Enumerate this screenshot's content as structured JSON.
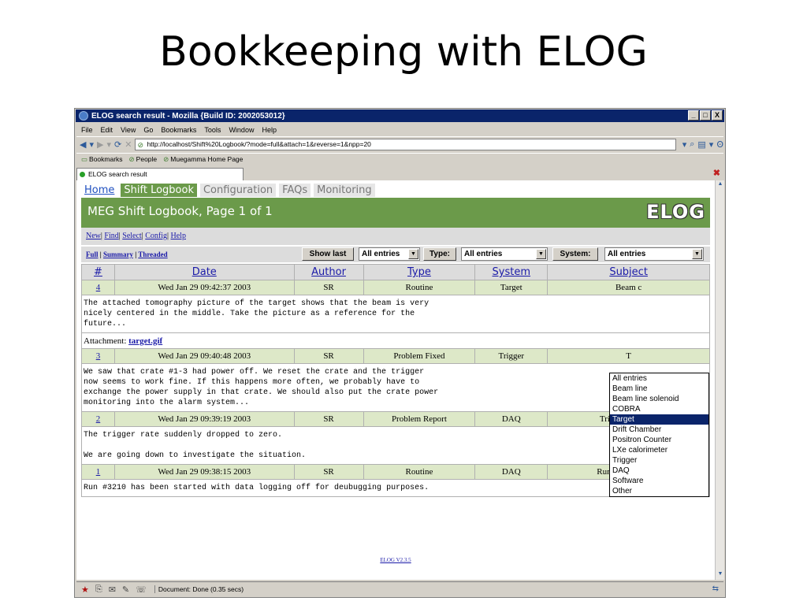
{
  "slide": {
    "title": "Bookkeeping with ELOG"
  },
  "window": {
    "title": "ELOG search result - Mozilla {Build ID: 2002053012}",
    "controls": [
      "_",
      "□",
      "X"
    ]
  },
  "menu": [
    "File",
    "Edit",
    "View",
    "Go",
    "Bookmarks",
    "Tools",
    "Window",
    "Help"
  ],
  "nav": {
    "url": "http://localhost/Shift%20Logbook/?mode=full&attach=1&reverse=1&npp=20"
  },
  "bookmarks": [
    "Bookmarks",
    "People",
    "Muegamma Home Page"
  ],
  "browser_tab": {
    "label": "ELOG search result"
  },
  "status": {
    "text": "Document: Done (0.35 secs)"
  },
  "elog": {
    "tabs": [
      "Home",
      "Shift Logbook",
      "Configuration",
      "FAQs",
      "Monitoring"
    ],
    "header_title": "MEG Shift Logbook, Page 1 of 1",
    "logo": "ELOG",
    "commands": [
      "New",
      "Find",
      "Select",
      "Config",
      "Help"
    ],
    "modes": [
      "Full",
      "Summary",
      "Threaded"
    ],
    "show_last_label": "Show last",
    "show_last_value": "All entries",
    "type_label": "Type:",
    "type_value": "All entries",
    "system_label": "System:",
    "system_value": "All entries",
    "columns": [
      "#",
      "Date",
      "Author",
      "Type",
      "System",
      "Subject"
    ],
    "system_options": [
      "All entries",
      "Beam line",
      "Beam line solenoid",
      "COBRA",
      "Target",
      "Drift Chamber",
      "Positron Counter",
      "LXe calorimeter",
      "Trigger",
      "DAQ",
      "Software",
      "Other"
    ],
    "system_selected_index": 4,
    "entries": [
      {
        "id": "4",
        "date": "Wed Jan 29 09:42:37 2003",
        "author": "SR",
        "type": "Routine",
        "system": "Target",
        "subject": "Beam c",
        "text": "The attached tomography picture of the target shows that the beam is very\nnicely centered in the middle. Take the picture as a reference for the\nfuture...",
        "attachment_label": "Attachment:",
        "attachment": "target.gif"
      },
      {
        "id": "3",
        "date": "Wed Jan 29 09:40:48 2003",
        "author": "SR",
        "type": "Problem Fixed",
        "system": "Trigger",
        "subject": "T",
        "text": "We saw that crate #1-3 had power off. We reset the crate and the trigger\nnow seems to work fine. If this happens more often, we probably have to\nexchange the power supply in that crate. We should also put the crate power\nmonitoring into the alarm system..."
      },
      {
        "id": "2",
        "date": "Wed Jan 29 09:39:19 2003",
        "author": "SR",
        "type": "Problem Report",
        "system": "DAQ",
        "subject": "Trigger rate zero",
        "text": "The trigger rate suddenly dropped to zero.\n\nWe are going down to investigate the situation."
      },
      {
        "id": "1",
        "date": "Wed Jan 29 09:38:15 2003",
        "author": "SR",
        "type": "Routine",
        "system": "DAQ",
        "subject": "Run #3210 started",
        "text": "Run #3210 has been started with data logging off for deubugging purposes."
      }
    ],
    "footer": "ELOG V2.3.5"
  }
}
